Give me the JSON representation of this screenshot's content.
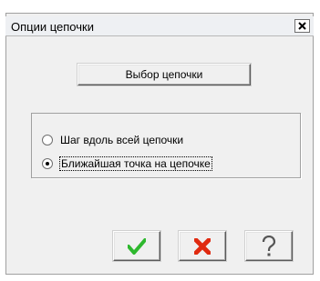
{
  "dialog": {
    "title": "Опции цепочки",
    "close_icon": "close-icon",
    "chain_select_label": "Выбор цепочки",
    "options": [
      {
        "label": "Шаг вдоль всей цепочки",
        "checked": false
      },
      {
        "label": "Ближайшая точка на цепочке",
        "checked": true
      }
    ],
    "buttons": {
      "ok_icon": "checkmark-icon",
      "cancel_icon": "cross-icon",
      "help_icon": "question-icon"
    },
    "colors": {
      "ok": "#2eb82e",
      "cancel": "#e02a10"
    }
  }
}
